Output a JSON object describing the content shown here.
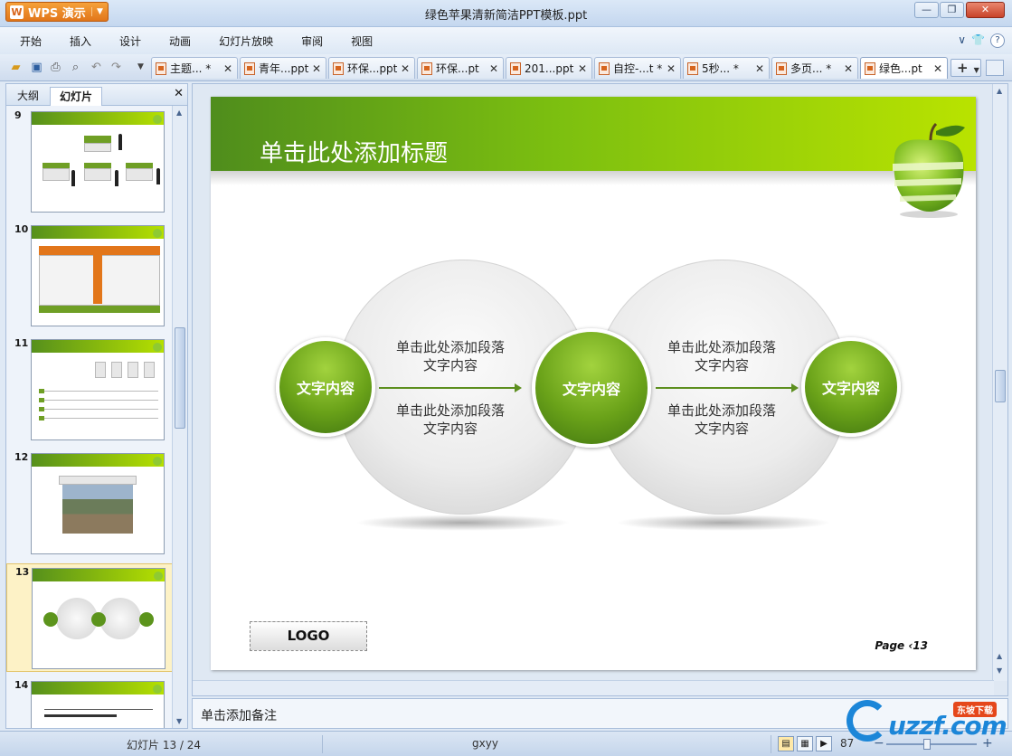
{
  "app": {
    "name": "WPS 演示",
    "title": "绿色苹果清新简洁PPT模板.ppt"
  },
  "window": {
    "minimize": "—",
    "restore": "❐",
    "close": "✕"
  },
  "menu": [
    "开始",
    "插入",
    "设计",
    "动画",
    "幻灯片放映",
    "审阅",
    "视图"
  ],
  "menu_right": {
    "collapse": "∨",
    "shirt": "👕",
    "help": "?"
  },
  "doc_tabs": [
    {
      "label": "主题... *"
    },
    {
      "label": "青年...ppt"
    },
    {
      "label": "环保...ppt"
    },
    {
      "label": "环保...pt"
    },
    {
      "label": "201...ppt"
    },
    {
      "label": "自控-...t *"
    },
    {
      "label": "5秒... *"
    },
    {
      "label": "多页... *"
    },
    {
      "label": "绿色...pt"
    }
  ],
  "doc_tabs_add": "+",
  "panel": {
    "tab_outline": "大纲",
    "tab_slides": "幻灯片",
    "close": "✕"
  },
  "thumbnails": [
    {
      "num": "9"
    },
    {
      "num": "10"
    },
    {
      "num": "11"
    },
    {
      "num": "12"
    },
    {
      "num": "13"
    },
    {
      "num": "14"
    }
  ],
  "slide": {
    "title": "单击此处添加标题",
    "node1": "文字内容",
    "node2": "文字内容",
    "node3": "文字内容",
    "para1a": "单击此处添加段落文字内容",
    "para1b": "单击此处添加段落文字内容",
    "para2a": "单击此处添加段落文字内容",
    "para2b": "单击此处添加段落文字内容",
    "logo": "LOGO",
    "page": "Page ‹13"
  },
  "notes": "单击添加备注",
  "status": {
    "slide": "幻灯片 13 / 24",
    "theme": "gxyy",
    "zoom": "87"
  },
  "watermark": {
    "text": "uzzf.com",
    "badge": "东坡下载"
  }
}
